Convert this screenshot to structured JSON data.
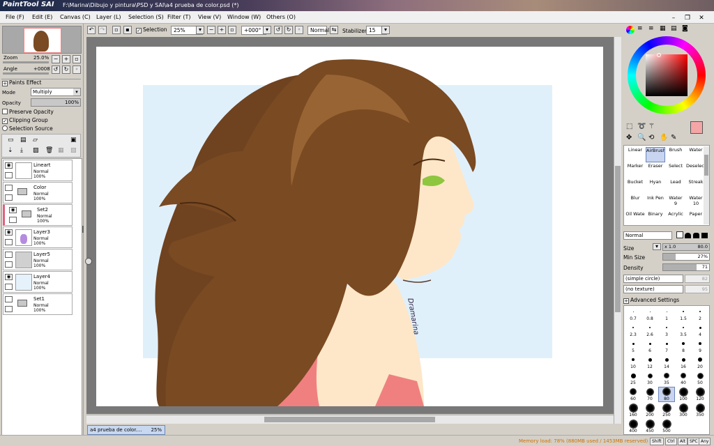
{
  "app": {
    "logo": "PaintTool SAI",
    "title": "F:\\Marina\\Dibujo y pintura\\PSD y SAI\\a4 prueba de color.psd (*)"
  },
  "menu": [
    {
      "label": "File (F)"
    },
    {
      "label": "Edit (E)"
    },
    {
      "label": "Canvas (C)"
    },
    {
      "label": "Layer (L)"
    },
    {
      "label": "Selection (S)"
    },
    {
      "label": "Filter (T)"
    },
    {
      "label": "View (V)"
    },
    {
      "label": "Window (W)"
    },
    {
      "label": "Others (O)"
    }
  ],
  "navigator": {
    "zoom_label": "Zoom",
    "zoom_value": "25.0%",
    "angle_label": "Angle",
    "angle_value": "+0008"
  },
  "paints_effect": "Paints Effect",
  "layer_props": {
    "mode_label": "Mode",
    "mode_value": "Multiply",
    "opacity_label": "Opacity",
    "opacity_value": "100%",
    "preserve_opacity": "Preserve Opacity",
    "clipping_group": "Clipping Group",
    "selection_source": "Selection Source"
  },
  "layers": [
    {
      "name": "Lineart",
      "mode": "Normal",
      "opacity": "100%",
      "visible": true,
      "type": "layer"
    },
    {
      "name": "Color",
      "mode": "Normal",
      "opacity": "100%",
      "visible": false,
      "type": "folder"
    },
    {
      "name": "Set2",
      "mode": "Normal",
      "opacity": "100%",
      "visible": true,
      "type": "folder"
    },
    {
      "name": "Layer3",
      "mode": "Normal",
      "opacity": "100%",
      "visible": true,
      "type": "layer"
    },
    {
      "name": "Layer5",
      "mode": "Normal",
      "opacity": "100%",
      "visible": false,
      "type": "layer"
    },
    {
      "name": "Layer4",
      "mode": "Normal",
      "opacity": "100%",
      "visible": true,
      "type": "layer"
    },
    {
      "name": "Set1",
      "mode": "Normal",
      "opacity": "100%",
      "visible": false,
      "type": "folder"
    }
  ],
  "toolbar": {
    "selection_label": "Selection",
    "zoom": "25%",
    "angle": "+000°",
    "blend": "Normal",
    "stabilizer_label": "Stabilizer",
    "stabilizer_value": "15"
  },
  "document_tab": {
    "name": "a4 prueba de color....",
    "zoom": "25%"
  },
  "colors": {
    "primary": "#f4a6a6",
    "secondary": "#ffffff",
    "hair": "#7a4a22",
    "skin": "#fde7c8",
    "shirt": "#f08080",
    "eye": "#8ec63f",
    "bg": "#e0f0fb"
  },
  "signature": "Dramarina",
  "tools": [
    {
      "label": "Linear"
    },
    {
      "label": "AirBrush",
      "selected": true
    },
    {
      "label": "Brush"
    },
    {
      "label": "Water"
    },
    {
      "label": "Marker"
    },
    {
      "label": "Eraser"
    },
    {
      "label": "Select"
    },
    {
      "label": "Deselect"
    },
    {
      "label": "Bucket"
    },
    {
      "label": "Hyan"
    },
    {
      "label": "Lead"
    },
    {
      "label": "Streak"
    },
    {
      "label": "Blur"
    },
    {
      "label": "Ink Pen"
    },
    {
      "label": "Water"
    },
    {
      "label": "Water"
    },
    {
      "label": "Oil Wate"
    },
    {
      "label": "Binary"
    },
    {
      "label": "Acrylic"
    },
    {
      "label": "Paper"
    }
  ],
  "tool_numbers": [
    "9",
    "10"
  ],
  "brush": {
    "mode": "Normal",
    "size_label": "Size",
    "size_mult": "x 1.0",
    "size_value": "80.0",
    "minsize_label": "Min Size",
    "minsize_value": "27%",
    "density_label": "Density",
    "density_value": "71",
    "shape": "(simple circle)",
    "shape_value": "82",
    "texture": "(no texture)",
    "texture_value": "95",
    "advanced": "Advanced Settings"
  },
  "brush_sizes": [
    "0.7",
    "0.8",
    "1",
    "1.5",
    "2",
    "2.3",
    "2.6",
    "3",
    "3.5",
    "4",
    "5",
    "6",
    "7",
    "8",
    "9",
    "10",
    "12",
    "14",
    "16",
    "20",
    "25",
    "30",
    "35",
    "40",
    "50",
    "60",
    "70",
    "80",
    "100",
    "120",
    "160",
    "200",
    "250",
    "300",
    "350",
    "400",
    "450",
    "500"
  ],
  "status": {
    "memory": "Memory load: 78% (880MB used / 1453MB reserved)",
    "keys": [
      "Shift",
      "Ctrl",
      "Alt",
      "SPC",
      "Any"
    ]
  }
}
